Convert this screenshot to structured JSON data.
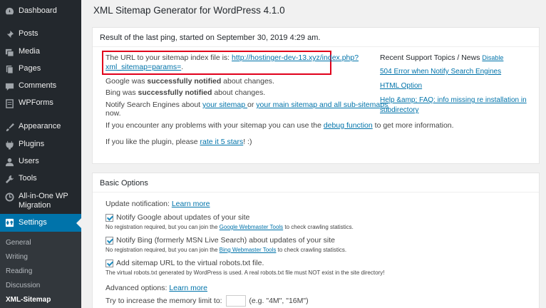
{
  "sidebar": {
    "items": [
      {
        "label": "Dashboard",
        "icon": "dashboard-icon"
      },
      {
        "label": "Posts",
        "icon": "pin-icon"
      },
      {
        "label": "Media",
        "icon": "media-icon"
      },
      {
        "label": "Pages",
        "icon": "pages-icon"
      },
      {
        "label": "Comments",
        "icon": "comment-icon"
      },
      {
        "label": "WPForms",
        "icon": "forms-icon"
      },
      {
        "label": "Appearance",
        "icon": "brush-icon"
      },
      {
        "label": "Plugins",
        "icon": "plugin-icon"
      },
      {
        "label": "Users",
        "icon": "user-icon"
      },
      {
        "label": "Tools",
        "icon": "wrench-icon"
      },
      {
        "label": "All-in-One WP Migration",
        "icon": "migration-icon"
      },
      {
        "label": "Settings",
        "icon": "settings-icon"
      }
    ],
    "submenu": [
      "General",
      "Writing",
      "Reading",
      "Discussion",
      "XML-Sitemap"
    ]
  },
  "page": {
    "title": "XML Sitemap Generator for WordPress 4.1.0"
  },
  "ping": {
    "head": "Result of the last ping, started on September 30, 2019 4:29 am.",
    "url_prefix": "The URL to your sitemap index file is: ",
    "url_line1": "http://hostinger-dev-13.xyz/index.php?",
    "url_line2": "xml_sitemap=params=",
    "url_dot": ".",
    "google_a": "Google was ",
    "google_b": "successfully notified",
    "google_c": " about changes.",
    "bing_a": "Bing was ",
    "bing_b": "successfully notified",
    "bing_c": " about changes.",
    "notify_a": "Notify Search Engines about ",
    "notify_link1": "your sitemap ",
    "notify_or": "or ",
    "notify_link2": "your main sitemap and all sub-sitemaps",
    "notify_b": "now.",
    "problem_a": "If you encounter any problems with your sitemap you can use the ",
    "problem_link": "debug function",
    "problem_b": " to get more information.",
    "like_a": "If you like the plugin, please ",
    "like_link": "rate it 5 stars",
    "like_b": "! :)"
  },
  "support": {
    "head": "Recent Support Topics / News ",
    "disable": "Disable",
    "topics": [
      "504 Error when Notify Search Engines",
      "HTML Option",
      "Help &amp; FAQ: info missing re installation in",
      "subdirectory"
    ]
  },
  "basic": {
    "head": "Basic Options",
    "update_label": "Update notification: ",
    "learn_more": "Learn more",
    "cb_google": "Notify Google about updates of your site",
    "note_google_a": "No registration required, but you can join the ",
    "note_google_link": "Google Webmaster Tools",
    "note_google_b": " to check crawling statistics.",
    "cb_bing": "Notify Bing (formerly MSN Live Search) about updates of your site",
    "note_bing_a": "No registration required, but you can join the ",
    "note_bing_link": "Bing Webmaster Tools",
    "note_bing_b": " to check crawling statistics.",
    "cb_robots": "Add sitemap URL to the virtual robots.txt file.",
    "note_robots": "The virtual robots.txt generated by WordPress is used. A real robots.txt file must NOT exist in the site directory!",
    "advanced_label": "Advanced options: ",
    "advanced_learn": "Learn more",
    "memory_a": "Try to increase the memory limit to:",
    "memory_b": "(e.g. \"4M\", \"16M\")"
  }
}
